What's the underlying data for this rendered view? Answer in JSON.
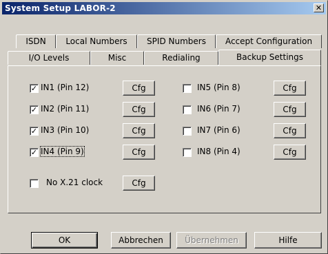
{
  "window": {
    "title": "System Setup  LABOR-2",
    "close_glyph": "✕"
  },
  "tabs_back": [
    "ISDN",
    "Local Numbers",
    "SPID Numbers",
    "Accept Configuration"
  ],
  "tabs_front": [
    "I/O Levels",
    "Misc",
    "Redialing",
    "Backup Settings"
  ],
  "active_tab": "Backup Settings",
  "inputs_left": [
    {
      "label": "IN1 (Pin 12)",
      "checked": true
    },
    {
      "label": "IN2 (Pin 11)",
      "checked": true
    },
    {
      "label": "IN3 (Pin 10)",
      "checked": true
    },
    {
      "label": "IN4 (Pin 9)",
      "checked": true,
      "focused": true
    }
  ],
  "inputs_right": [
    {
      "label": "IN5 (Pin 8)",
      "checked": false
    },
    {
      "label": "IN6 (Pin 7)",
      "checked": false
    },
    {
      "label": "IN7 (Pin 6)",
      "checked": false
    },
    {
      "label": "IN8 (Pin 4)",
      "checked": false
    }
  ],
  "clock": {
    "label": "No X.21 clock",
    "checked": false
  },
  "cfg_label": "Cfg",
  "buttons": {
    "ok": "OK",
    "cancel": "Abbrechen",
    "apply": "Übernehmen",
    "help": "Hilfe"
  }
}
